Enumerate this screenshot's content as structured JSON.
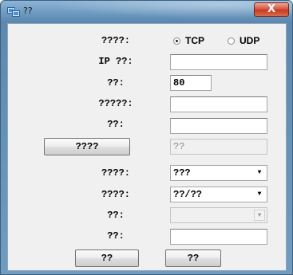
{
  "window": {
    "title": "??",
    "close_label": "X"
  },
  "icons": {
    "app": "network-app-icon",
    "close": "close-icon"
  },
  "protocol": {
    "label": "????:",
    "options": [
      "TCP",
      "UDP"
    ],
    "selected": "TCP"
  },
  "ip": {
    "label": "IP ??:",
    "value": ""
  },
  "port": {
    "label": "??:",
    "value": "80"
  },
  "field3": {
    "label": "?????:",
    "value": ""
  },
  "field4": {
    "label": "??:",
    "value": ""
  },
  "browse": {
    "button_label": "????",
    "value": "??"
  },
  "combo1": {
    "label": "????:",
    "value": "???"
  },
  "combo2": {
    "label": "????:",
    "value": "??/??"
  },
  "combo3": {
    "label": "??:",
    "value": ""
  },
  "field5": {
    "label": "??:",
    "value": ""
  },
  "actions": {
    "ok_label": "??",
    "cancel_label": "??"
  }
}
